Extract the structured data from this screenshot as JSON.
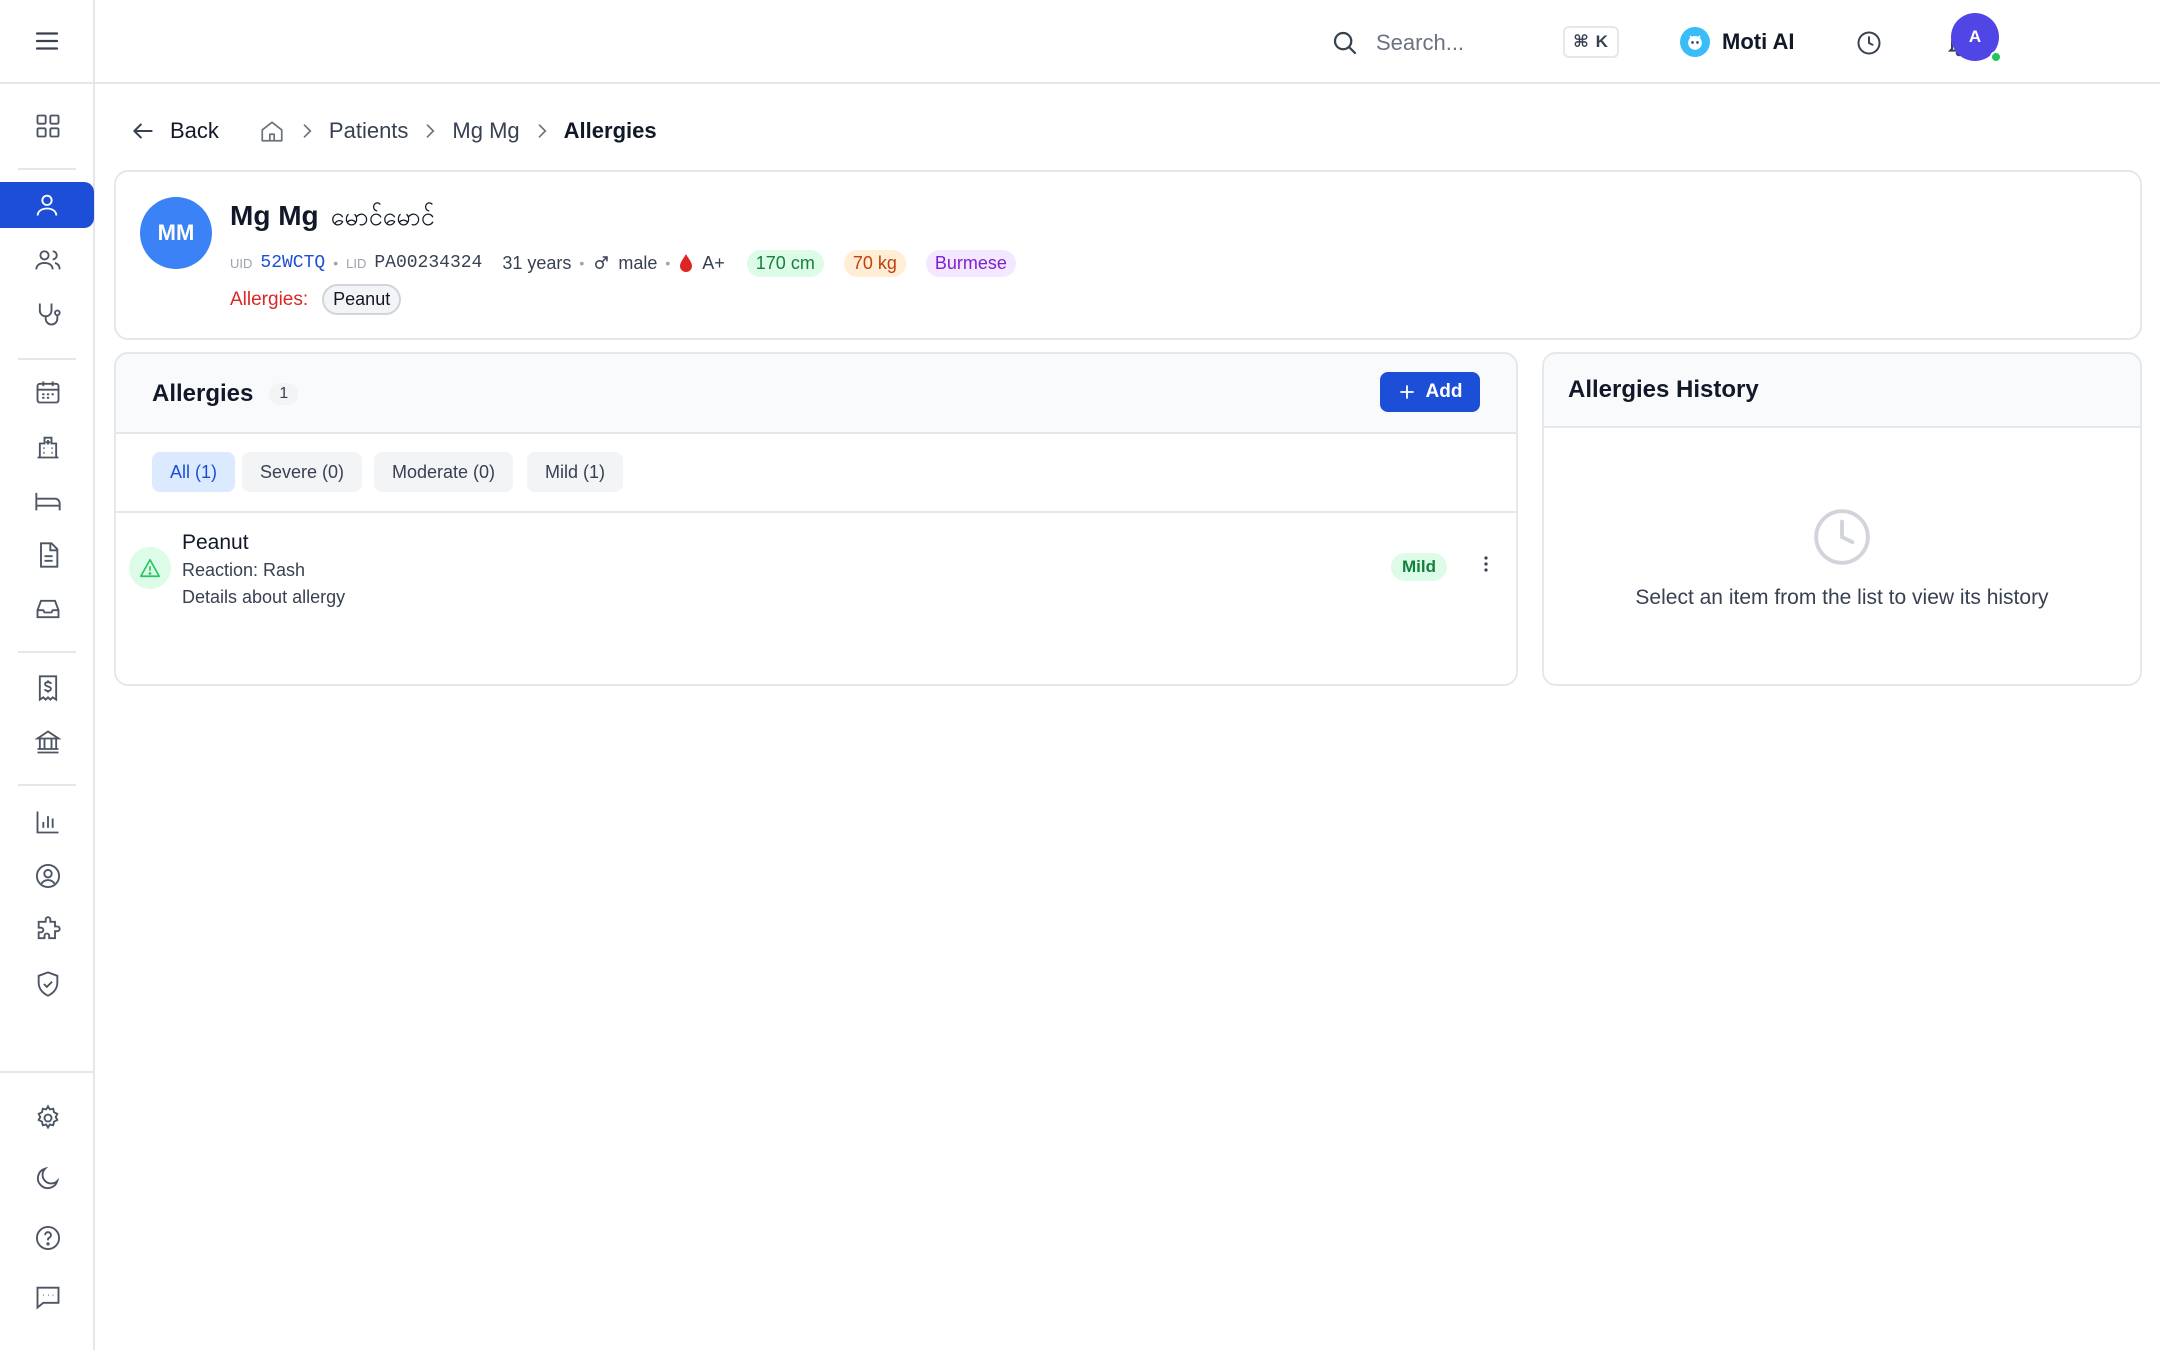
{
  "header": {
    "search_placeholder": "Search...",
    "shortcut": "⌘ K",
    "ai_label": "Moti AI",
    "user_initial": "A"
  },
  "breadcrumb": {
    "back": "Back",
    "items": [
      "Patients",
      "Mg Mg",
      "Allergies"
    ]
  },
  "patient": {
    "initials": "MM",
    "name": "Mg Mg",
    "name_local": "မောင်မောင်",
    "uid_label": "UID",
    "uid": "52WCTQ",
    "lid_label": "LID",
    "lid": "PA00234324",
    "age": "31 years",
    "gender": "male",
    "blood": "A+",
    "height": "170 cm",
    "weight": "70 kg",
    "ethnicity": "Burmese",
    "allergies_label": "Allergies:",
    "allergies": [
      "Peanut"
    ]
  },
  "allergies_panel": {
    "title": "Allergies",
    "count": "1",
    "add_label": "Add",
    "filters": [
      "All (1)",
      "Severe (0)",
      "Moderate (0)",
      "Mild (1)"
    ],
    "items": [
      {
        "name": "Peanut",
        "reaction": "Reaction: Rash",
        "details": "Details about allergy",
        "severity": "Mild"
      }
    ]
  },
  "history_panel": {
    "title": "Allergies History",
    "empty_text": "Select an item from the list to view its history"
  },
  "colors": {
    "primary": "#1d4ed8",
    "avatar_patient": "#3b82f6",
    "avatar_user": "#4f46e5",
    "allergy_label": "#dc2626",
    "mild": "#15803d"
  }
}
